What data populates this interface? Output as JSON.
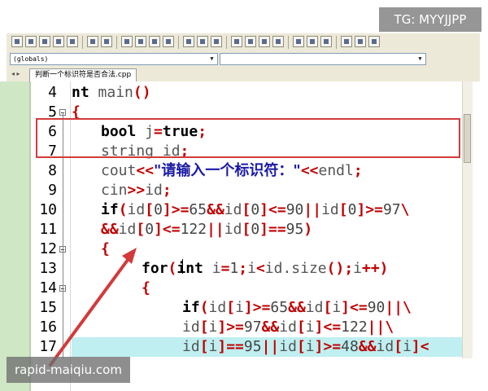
{
  "watermarks": {
    "top_right": "TG: MYYJJPP",
    "bottom_left": "rapid-maiqiu.com"
  },
  "toolbar": {
    "buttons": [
      "new-file",
      "open-file",
      "save",
      "save-all",
      "print",
      "undo",
      "redo",
      "find",
      "find-next",
      "replace",
      "goto",
      "bookmark-prev",
      "bookmark-next",
      "toggle-bookmark",
      "grid-1",
      "grid-2",
      "grid-3",
      "grid-4",
      "compile-check",
      "chart",
      "close-red-x",
      "build",
      "run",
      "debug"
    ]
  },
  "combos": {
    "scope": "(globals)",
    "member": ""
  },
  "tabs": {
    "file_name": "判断一个标识符是否合法.cpp"
  },
  "colors": {
    "keyword": "#000000",
    "operator": "#c00000",
    "string": "#1a1aa6",
    "highlight_box": "#d33a3a",
    "line_highlight": "#bfeff0",
    "left_panel": "#cfe7c4"
  },
  "code": {
    "lines": [
      {
        "num": "4",
        "fold": false,
        "tokens": [
          [
            "kw",
            "nt "
          ],
          [
            "id",
            "main"
          ],
          [
            "op",
            "()"
          ]
        ]
      },
      {
        "num": "5",
        "fold": true,
        "tokens": [
          [
            "op",
            "{"
          ]
        ]
      },
      {
        "num": "6",
        "fold": false,
        "tokens": [
          [
            "kw",
            "bool "
          ],
          [
            "id",
            "j"
          ],
          [
            "op",
            "="
          ],
          [
            "kw",
            "true"
          ],
          [
            "op",
            ";"
          ]
        ]
      },
      {
        "num": "7",
        "fold": false,
        "tokens": [
          [
            "id",
            "string id"
          ],
          [
            "op",
            ";"
          ]
        ]
      },
      {
        "num": "8",
        "fold": false,
        "tokens": [
          [
            "id",
            "cout"
          ],
          [
            "op",
            "<<"
          ],
          [
            "str",
            "\"请输入一个标识符：\""
          ],
          [
            "op",
            "<<"
          ],
          [
            "id",
            "endl"
          ],
          [
            "op",
            ";"
          ]
        ]
      },
      {
        "num": "9",
        "fold": false,
        "tokens": [
          [
            "id",
            "cin"
          ],
          [
            "op",
            ">>"
          ],
          [
            "id",
            "id"
          ],
          [
            "op",
            ";"
          ]
        ]
      },
      {
        "num": "10",
        "fold": false,
        "tokens": [
          [
            "kw",
            "if"
          ],
          [
            "op",
            "("
          ],
          [
            "id",
            "id"
          ],
          [
            "op",
            "["
          ],
          [
            "num",
            "0"
          ],
          [
            "op",
            "]>="
          ],
          [
            "num",
            "65"
          ],
          [
            "op",
            "&&"
          ],
          [
            "id",
            "id"
          ],
          [
            "op",
            "["
          ],
          [
            "num",
            "0"
          ],
          [
            "op",
            "]<="
          ],
          [
            "num",
            "90"
          ],
          [
            "op",
            "||"
          ],
          [
            "id",
            "id"
          ],
          [
            "op",
            "["
          ],
          [
            "num",
            "0"
          ],
          [
            "op",
            "]>="
          ],
          [
            "num",
            "97"
          ],
          [
            "op",
            "\\"
          ]
        ]
      },
      {
        "num": "11",
        "fold": false,
        "tokens": [
          [
            "op",
            "&&"
          ],
          [
            "id",
            "id"
          ],
          [
            "op",
            "["
          ],
          [
            "num",
            "0"
          ],
          [
            "op",
            "]<="
          ],
          [
            "num",
            "122"
          ],
          [
            "op",
            "||"
          ],
          [
            "id",
            "id"
          ],
          [
            "op",
            "["
          ],
          [
            "num",
            "0"
          ],
          [
            "op",
            "]=="
          ],
          [
            "num",
            "95"
          ],
          [
            "op",
            ")"
          ]
        ]
      },
      {
        "num": "12",
        "fold": true,
        "tokens": [
          [
            "op",
            "{"
          ]
        ]
      },
      {
        "num": "13",
        "fold": false,
        "tokens": [
          [
            "kw",
            "for"
          ],
          [
            "op",
            "("
          ],
          [
            "kw",
            "int "
          ],
          [
            "id",
            "i"
          ],
          [
            "op",
            "="
          ],
          [
            "num",
            "1"
          ],
          [
            "op",
            ";"
          ],
          [
            "id",
            "i"
          ],
          [
            "op",
            "<"
          ],
          [
            "id",
            "id.size"
          ],
          [
            "op",
            "();"
          ],
          [
            "id",
            "i"
          ],
          [
            "op",
            "++)"
          ]
        ]
      },
      {
        "num": "14",
        "fold": true,
        "tokens": [
          [
            "op",
            "{"
          ]
        ]
      },
      {
        "num": "15",
        "fold": false,
        "tokens": [
          [
            "kw",
            "if"
          ],
          [
            "op",
            "("
          ],
          [
            "id",
            "id"
          ],
          [
            "op",
            "["
          ],
          [
            "id",
            "i"
          ],
          [
            "op",
            "]>="
          ],
          [
            "num",
            "65"
          ],
          [
            "op",
            "&&"
          ],
          [
            "id",
            "id"
          ],
          [
            "op",
            "["
          ],
          [
            "id",
            "i"
          ],
          [
            "op",
            "]<="
          ],
          [
            "num",
            "90"
          ],
          [
            "op",
            "||\\"
          ]
        ]
      },
      {
        "num": "16",
        "fold": false,
        "tokens": [
          [
            "id",
            "id"
          ],
          [
            "op",
            "["
          ],
          [
            "id",
            "i"
          ],
          [
            "op",
            "]>="
          ],
          [
            "num",
            "97"
          ],
          [
            "op",
            "&&"
          ],
          [
            "id",
            "id"
          ],
          [
            "op",
            "["
          ],
          [
            "id",
            "i"
          ],
          [
            "op",
            "]<="
          ],
          [
            "num",
            "122"
          ],
          [
            "op",
            "||\\"
          ]
        ]
      },
      {
        "num": "17",
        "fold": false,
        "tokens": [
          [
            "id",
            "id"
          ],
          [
            "op",
            "["
          ],
          [
            "id",
            "i"
          ],
          [
            "op",
            "]=="
          ],
          [
            "num",
            "95"
          ],
          [
            "op",
            "||"
          ],
          [
            "id",
            "id"
          ],
          [
            "op",
            "["
          ],
          [
            "id",
            "i"
          ],
          [
            "op",
            "]>="
          ],
          [
            "num",
            "48"
          ],
          [
            "op",
            "&&"
          ],
          [
            "id",
            "id"
          ],
          [
            "op",
            "["
          ],
          [
            "id",
            "i"
          ],
          [
            "op",
            "]<"
          ]
        ]
      }
    ]
  }
}
